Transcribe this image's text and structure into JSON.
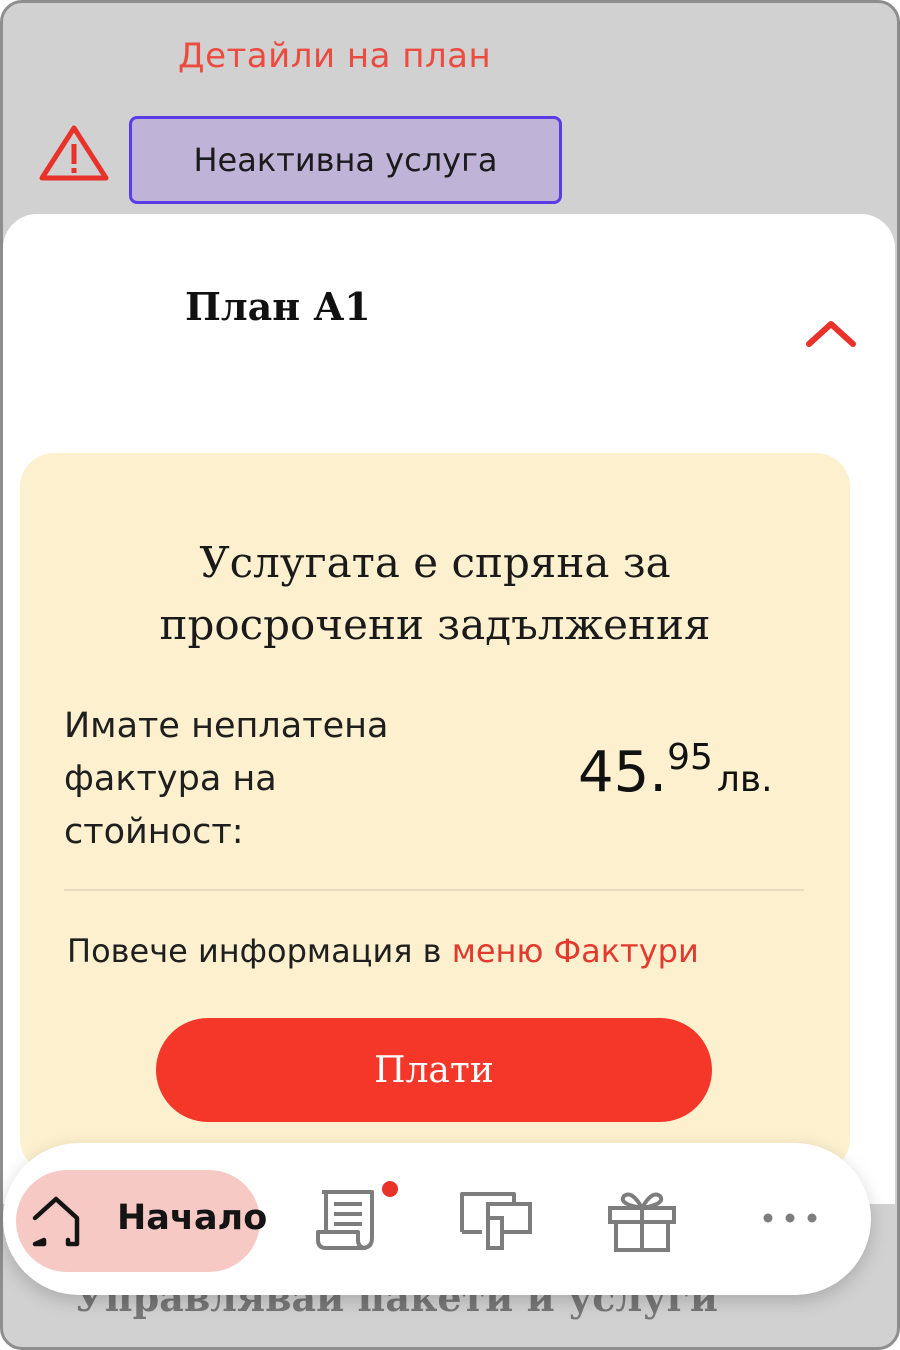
{
  "header": {
    "plan_details_link": "Детайли на план",
    "inactive_badge": "Неактивна услуга"
  },
  "plan": {
    "title": "План А1"
  },
  "notice": {
    "heading_line1": "Услугата е спряна за",
    "heading_line2": "просрочени задължения",
    "unpaid_line1": "Имате неплатена",
    "unpaid_line2": "фактура на",
    "unpaid_line3": "стойност:",
    "amount_int": "45.",
    "amount_frac": "95",
    "amount_currency": "лв.",
    "more_info_prefix": "Повече информация в ",
    "more_info_link": "меню Фактури",
    "pay_button": "Плати"
  },
  "background": {
    "heading_fragment": "Управлявай пакети и услуги"
  },
  "bottom_nav": {
    "home_label": "Начало",
    "items": [
      {
        "icon": "home-icon",
        "active": true
      },
      {
        "icon": "invoices-icon",
        "badge": true
      },
      {
        "icon": "devices-icon"
      },
      {
        "icon": "gift-icon"
      },
      {
        "icon": "more-icon"
      }
    ]
  },
  "colors": {
    "accent_red": "#f5372a",
    "link_red": "#e23a2e",
    "badge_purple": "#bfb3d8",
    "badge_border": "#5a3de6",
    "card_bg": "#fcf0cf",
    "home_pill": "#f6c9c5"
  }
}
